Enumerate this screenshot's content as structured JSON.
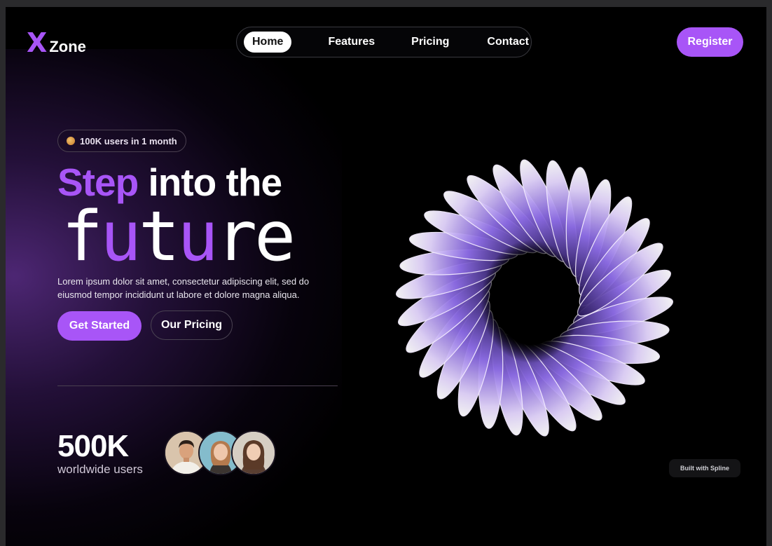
{
  "logo": {
    "mark": "X",
    "name": "Zone"
  },
  "nav": {
    "items": [
      "Home",
      "Features",
      "Pricing",
      "Contact"
    ],
    "active": "Home"
  },
  "register_label": "Register",
  "badge": {
    "text": "100K users in 1 month",
    "icon": "emoji-face-icon"
  },
  "hero": {
    "headline_accent": "Step",
    "headline_rest": " into the",
    "future_letters": [
      "f",
      "u",
      "t",
      "u",
      "r",
      "e"
    ],
    "description": "Lorem ipsum dolor sit amet, consectetur adipiscing elit, sed do eiusmod tempor incididunt ut labore et dolore magna aliqua.",
    "primary_button": "Get Started",
    "secondary_button": "Our Pricing"
  },
  "stats": {
    "number": "500K",
    "label": "worldwide users",
    "avatars": [
      "avatar-man",
      "avatar-woman-1",
      "avatar-woman-2"
    ]
  },
  "spline_badge": "Built with Spline",
  "colors": {
    "accent": "#a855f7",
    "background": "#000000",
    "text": "#ffffff"
  }
}
